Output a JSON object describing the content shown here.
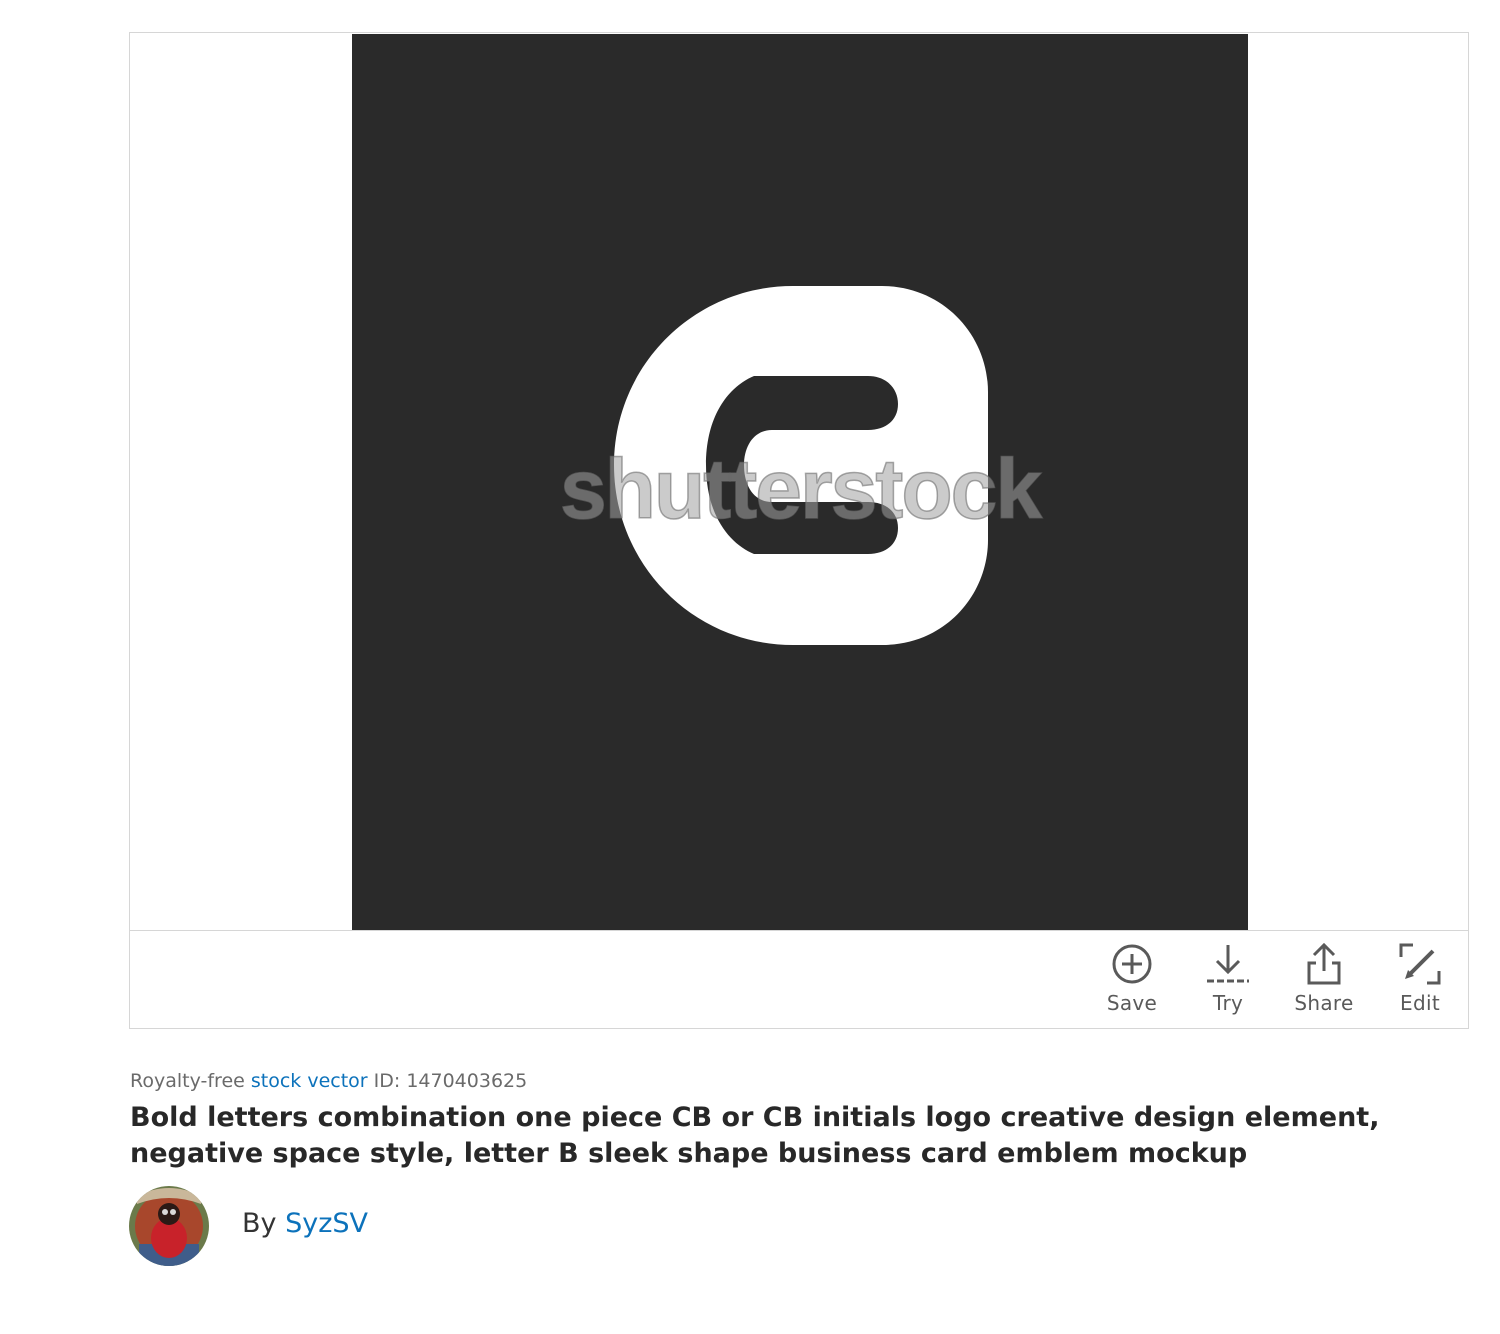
{
  "image": {
    "watermark_text": "shutterstock",
    "background_color": "#2a2a2a",
    "logo_color": "#ffffff"
  },
  "actions": {
    "save": {
      "label": "Save",
      "icon": "plus-circle-icon"
    },
    "try": {
      "label": "Try",
      "icon": "download-icon"
    },
    "share": {
      "label": "Share",
      "icon": "share-icon"
    },
    "edit": {
      "label": "Edit",
      "icon": "edit-pencil-icon"
    }
  },
  "meta": {
    "prefix": "Royalty-free",
    "type_link": "stock vector",
    "id_label": "ID: 1470403625"
  },
  "title": "Bold letters combination one piece CB or CB initials logo creative design element, negative space style, letter B sleek shape business card emblem mockup",
  "author": {
    "by_label": "By",
    "name": "SyzSV"
  },
  "colors": {
    "link": "#0c72bb",
    "icon": "#5a5a5a",
    "border": "#d6d6d6"
  }
}
